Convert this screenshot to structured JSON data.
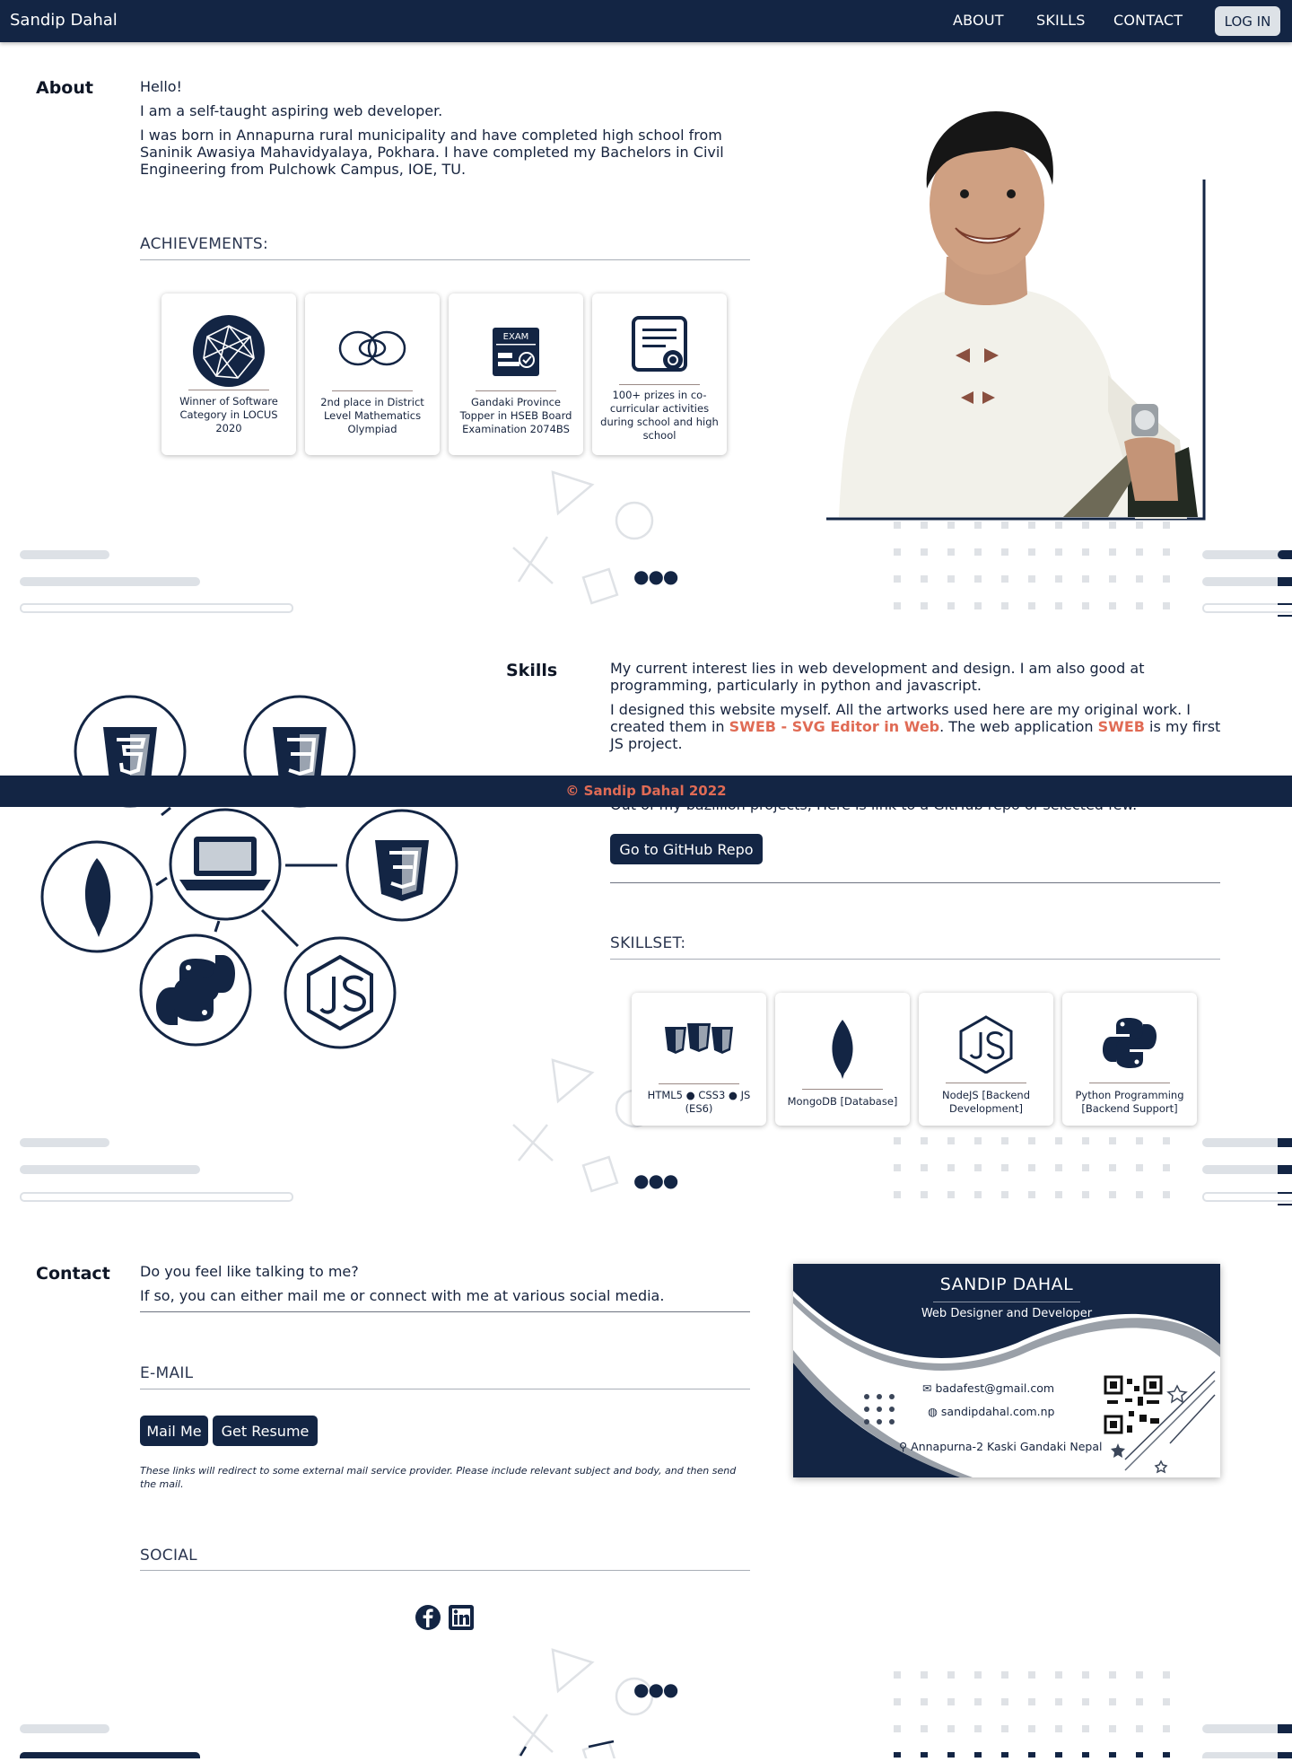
{
  "nav": {
    "brand": "Sandip Dahal",
    "links": [
      "ABOUT",
      "SKILLS",
      "CONTACT"
    ],
    "login": "LOG IN"
  },
  "about": {
    "title": "About",
    "greeting": "Hello!",
    "intro": "I am a self-taught aspiring web developer.",
    "bio": "I was born in Annapurna rural municipality and have completed high school from Saninik Awasiya Mahavidyalaya, Pokhara. I have completed my Bachelors in Civil Engineering from Pulchowk Campus, IOE, TU.",
    "achievements_heading": "ACHIEVEMENTS:",
    "achievements": [
      {
        "icon": "network-globe-icon",
        "text": "Winner of Software Category in LOCUS 2020"
      },
      {
        "icon": "infinity-icon",
        "text": "2nd place in District Level Mathematics Olympiad"
      },
      {
        "icon": "exam-icon",
        "text": "Gandaki Province Topper in HSEB Board Examination 2074BS"
      },
      {
        "icon": "certificate-icon",
        "text": "100+ prizes in co-curricular activities during school and high school"
      }
    ]
  },
  "skills": {
    "title": "Skills",
    "p1": "My current interest lies in web development and design. I am also good at programming, particularly in python and javascript.",
    "p2_a": "I designed this website myself. All the artworks used here are my original work. I created them in ",
    "p2_link1": "SWEB - SVG Editor in Web",
    "p2_b": ". The web application ",
    "p2_link2": "SWEB",
    "p2_c": " is my first JS project.",
    "p3": "Out of my bazillion projects, Here is link to a GitHub repo of selected few.",
    "github_button": "Go to GitHub Repo",
    "skillset_heading": "SKILLSET:",
    "skillset": [
      {
        "icon": "html-css-js-shields-icon",
        "text": "HTML5 ● CSS3 ● JS (ES6)"
      },
      {
        "icon": "mongodb-leaf-icon",
        "text": "MongoDB [Database]"
      },
      {
        "icon": "nodejs-icon",
        "text": "NodeJS [Backend Development]"
      },
      {
        "icon": "python-icon",
        "text": "Python Programming [Backend Support]"
      }
    ]
  },
  "footer": "© Sandip Dahal 2022",
  "contact": {
    "title": "Contact",
    "p1": "Do you feel like talking to me?",
    "p2": "If so, you can either mail me or connect with me at various social media.",
    "email_heading": "E-MAIL",
    "mail_button": "Mail Me",
    "resume_button": "Get Resume",
    "note": "These links will redirect to some external mail service provider. Please include relevant subject and body, and then send the mail.",
    "social_heading": "SOCIAL",
    "social": [
      "facebook-icon",
      "linkedin-icon"
    ]
  },
  "business_card": {
    "name": "SANDIP DAHAL",
    "role": "Web Designer and Developer",
    "email": "badafest@gmail.com",
    "website": "sandipdahal.com.np",
    "address": "Annapurna-2 Kaski Gandaki Nepal"
  },
  "colors": {
    "navy": "#132544",
    "accent": "#e06b55",
    "light": "#dde1e6"
  }
}
